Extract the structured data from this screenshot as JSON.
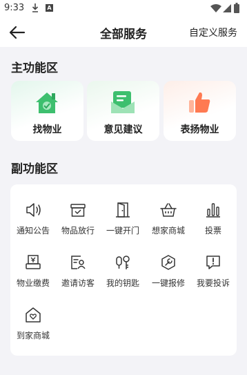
{
  "status_bar": {
    "time": "9:33",
    "notification_letter": "A"
  },
  "header": {
    "title": "全部服务",
    "custom_label": "自定义服务"
  },
  "main_section": {
    "title": "主功能区",
    "cards": [
      {
        "label": "找物业",
        "icon": "house-icon"
      },
      {
        "label": "意见建议",
        "icon": "suggestion-icon"
      },
      {
        "label": "表扬物业",
        "icon": "thumbs-up-icon"
      }
    ]
  },
  "sub_section": {
    "title": "副功能区",
    "items": [
      {
        "label": "通知公告",
        "icon": "speaker-icon"
      },
      {
        "label": "物品放行",
        "icon": "box-check-icon"
      },
      {
        "label": "一键开门",
        "icon": "door-icon"
      },
      {
        "label": "想家商城",
        "icon": "shopping-basket-icon"
      },
      {
        "label": "投票",
        "icon": "bar-chart-icon"
      },
      {
        "label": "物业缴费",
        "icon": "yuan-payment-icon"
      },
      {
        "label": "邀请访客",
        "icon": "visitor-icon"
      },
      {
        "label": "我的钥匙",
        "icon": "key-icon"
      },
      {
        "label": "一键报修",
        "icon": "wrench-icon"
      },
      {
        "label": "我要投诉",
        "icon": "complaint-icon"
      },
      {
        "label": "到家商城",
        "icon": "home-heart-icon"
      }
    ]
  },
  "colors": {
    "accent_green": "#3dbf6e",
    "accent_orange": "#ff7a52",
    "icon_stroke": "#333333"
  }
}
